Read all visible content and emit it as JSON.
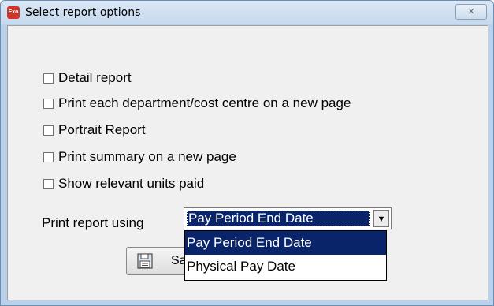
{
  "window": {
    "title": "Select report options",
    "app_icon_text": "Exo",
    "close_symbol": "✕"
  },
  "checkboxes": [
    {
      "label": "Detail report",
      "checked": false
    },
    {
      "label": "Print each department/cost centre on a new page",
      "checked": false
    },
    {
      "label": "Portrait Report",
      "checked": false
    },
    {
      "label": "Print summary on a new page",
      "checked": false
    },
    {
      "label": "Show relevant units paid",
      "checked": false
    }
  ],
  "print_using": {
    "label": "Print report using",
    "selected": "Pay Period End Date",
    "arrow": "▼",
    "options": [
      "Pay Period End Date",
      "Physical Pay Date"
    ]
  },
  "partial_button": {
    "visible_text": "Sa",
    "icon": "save-disk-icon"
  },
  "colors": {
    "selection": "#0a246a",
    "dialog_bg": "#f0f0f0",
    "frame": "#b9d1ea"
  }
}
